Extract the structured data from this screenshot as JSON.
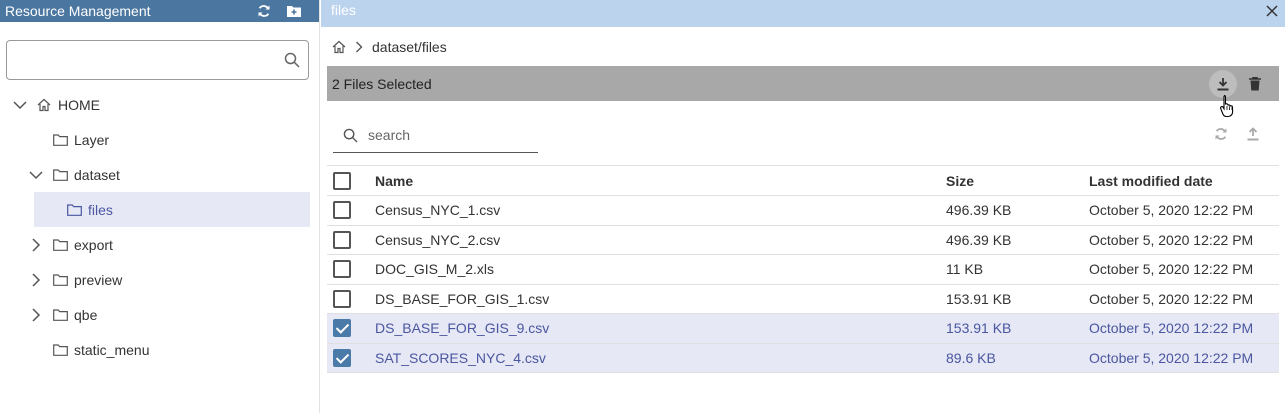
{
  "left_panel": {
    "title": "Resource Management",
    "header_icons": [
      "refresh-icon",
      "new-folder-icon"
    ],
    "search": {
      "value": "",
      "placeholder": ""
    },
    "tree": [
      {
        "label": "HOME",
        "level": 0,
        "toggle": "expanded",
        "icon": "home-icon",
        "selected": false
      },
      {
        "label": "Layer",
        "level": 1,
        "toggle": "none",
        "icon": "folder-icon",
        "selected": false
      },
      {
        "label": "dataset",
        "level": 1,
        "toggle": "expanded",
        "icon": "folder-icon",
        "selected": false
      },
      {
        "label": "files",
        "level": 2,
        "toggle": "none",
        "icon": "folder-icon",
        "selected": true
      },
      {
        "label": "export",
        "level": 1,
        "toggle": "collapsed",
        "icon": "folder-icon",
        "selected": false
      },
      {
        "label": "preview",
        "level": 1,
        "toggle": "collapsed",
        "icon": "folder-icon",
        "selected": false
      },
      {
        "label": "qbe",
        "level": 1,
        "toggle": "collapsed",
        "icon": "folder-icon",
        "selected": false
      },
      {
        "label": "static_menu",
        "level": 1,
        "toggle": "none",
        "icon": "folder-icon",
        "selected": false
      }
    ]
  },
  "right_panel": {
    "title": "files",
    "breadcrumb": {
      "path": "dataset/files"
    },
    "selection_bar": {
      "text": "2 Files Selected",
      "actions": [
        "download-icon",
        "delete-icon"
      ]
    },
    "search": {
      "placeholder": "search",
      "value": ""
    },
    "tools": [
      "refresh-icon",
      "upload-icon"
    ],
    "table": {
      "columns": [
        "Name",
        "Size",
        "Last modified date"
      ],
      "rows": [
        {
          "name": "Census_NYC_1.csv",
          "size": "496.39 KB",
          "modified": "October 5, 2020 12:22 PM",
          "checked": false
        },
        {
          "name": "Census_NYC_2.csv",
          "size": "496.39 KB",
          "modified": "October 5, 2020 12:22 PM",
          "checked": false
        },
        {
          "name": "DOC_GIS_M_2.xls",
          "size": "11 KB",
          "modified": "October 5, 2020 12:22 PM",
          "checked": false
        },
        {
          "name": "DS_BASE_FOR_GIS_1.csv",
          "size": "153.91 KB",
          "modified": "October 5, 2020 12:22 PM",
          "checked": false
        },
        {
          "name": "DS_BASE_FOR_GIS_9.csv",
          "size": "153.91 KB",
          "modified": "October 5, 2020 12:22 PM",
          "checked": true
        },
        {
          "name": "SAT_SCORES_NYC_4.csv",
          "size": "89.6 KB",
          "modified": "October 5, 2020 12:22 PM",
          "checked": true
        }
      ]
    }
  },
  "colors": {
    "left_header": "#4b76a0",
    "right_header": "#bcd3ee",
    "selection_bar": "#a8a8a8",
    "selected_row": "#e6e8f5",
    "selected_text": "#4a56a0",
    "checkbox_checked": "#4a7aa8"
  }
}
